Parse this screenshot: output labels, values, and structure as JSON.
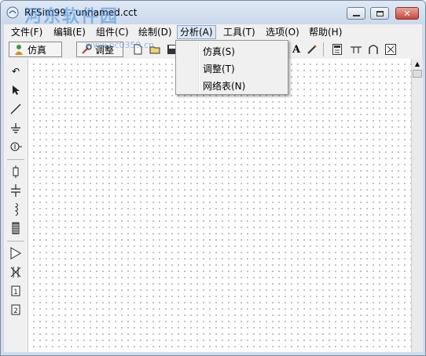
{
  "window": {
    "title": "RFSim99 - unnamed.cct",
    "watermark": "河东软件园",
    "watermark_sub": "www.pc0359.cn"
  },
  "menu": {
    "items": [
      {
        "label": "文件(F)"
      },
      {
        "label": "编辑(E)"
      },
      {
        "label": "组件(C)"
      },
      {
        "label": "绘制(D)"
      },
      {
        "label": "分析(A)"
      },
      {
        "label": "工具(T)"
      },
      {
        "label": "选项(O)"
      },
      {
        "label": "帮助(H)"
      }
    ],
    "open_menu": "分析(A)"
  },
  "analysis_menu": {
    "items": [
      {
        "label": "仿真(S)"
      },
      {
        "label": "调整(T)"
      },
      {
        "label": "网络表(N)"
      }
    ]
  },
  "toolbar": {
    "simulate_label": "仿真",
    "tune_label": "调整"
  },
  "icons": [
    "rotate-icon",
    "pointer-icon",
    "wire-icon",
    "ground-icon",
    "source-icon",
    "resistor-icon",
    "capacitor-icon",
    "inductor-icon",
    "transmission-line-icon",
    "amplifier-icon",
    "transformer-icon",
    "port1-icon",
    "port2-icon"
  ],
  "colors": {
    "title_bg": "#cfdceb",
    "close_button": "#c8473a",
    "watermark": "#468cdc"
  }
}
